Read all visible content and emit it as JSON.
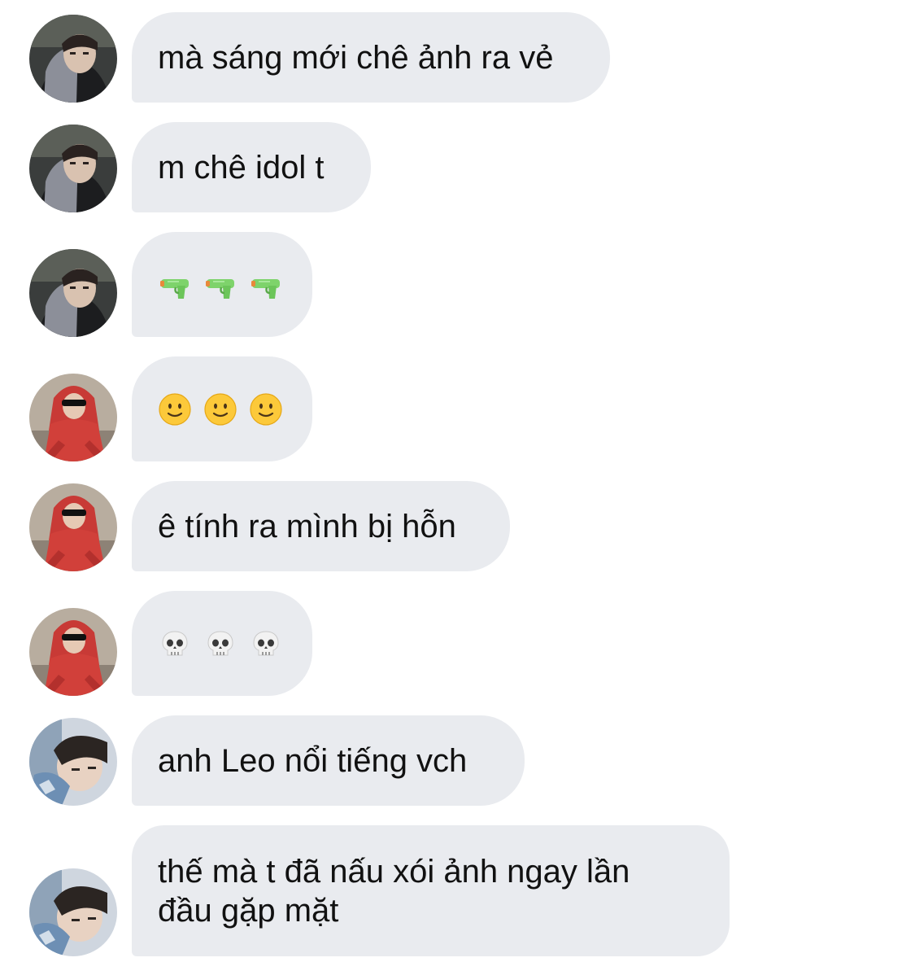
{
  "messages": [
    {
      "sender": "user-a",
      "text": "mà sáng mới chê ảnh ra vẻ"
    },
    {
      "sender": "user-a",
      "text": "m chê idol t"
    },
    {
      "sender": "user-a",
      "emoji": [
        "water-pistol",
        "water-pistol",
        "water-pistol"
      ]
    },
    {
      "sender": "user-b",
      "emoji": [
        "slightly-smiling-face",
        "slightly-smiling-face",
        "slightly-smiling-face"
      ]
    },
    {
      "sender": "user-b",
      "text": "ê tính ra mình bị hỗn"
    },
    {
      "sender": "user-b",
      "emoji": [
        "skull",
        "skull",
        "skull"
      ]
    },
    {
      "sender": "user-c",
      "text": "anh Leo nổi tiếng vch"
    },
    {
      "sender": "user-c",
      "text": "thế mà t đã nấu xói ảnh ngay lần đầu gặp mặt"
    }
  ],
  "colors": {
    "bubble": "#e9ebef",
    "text": "#111111",
    "background": "#ffffff"
  }
}
